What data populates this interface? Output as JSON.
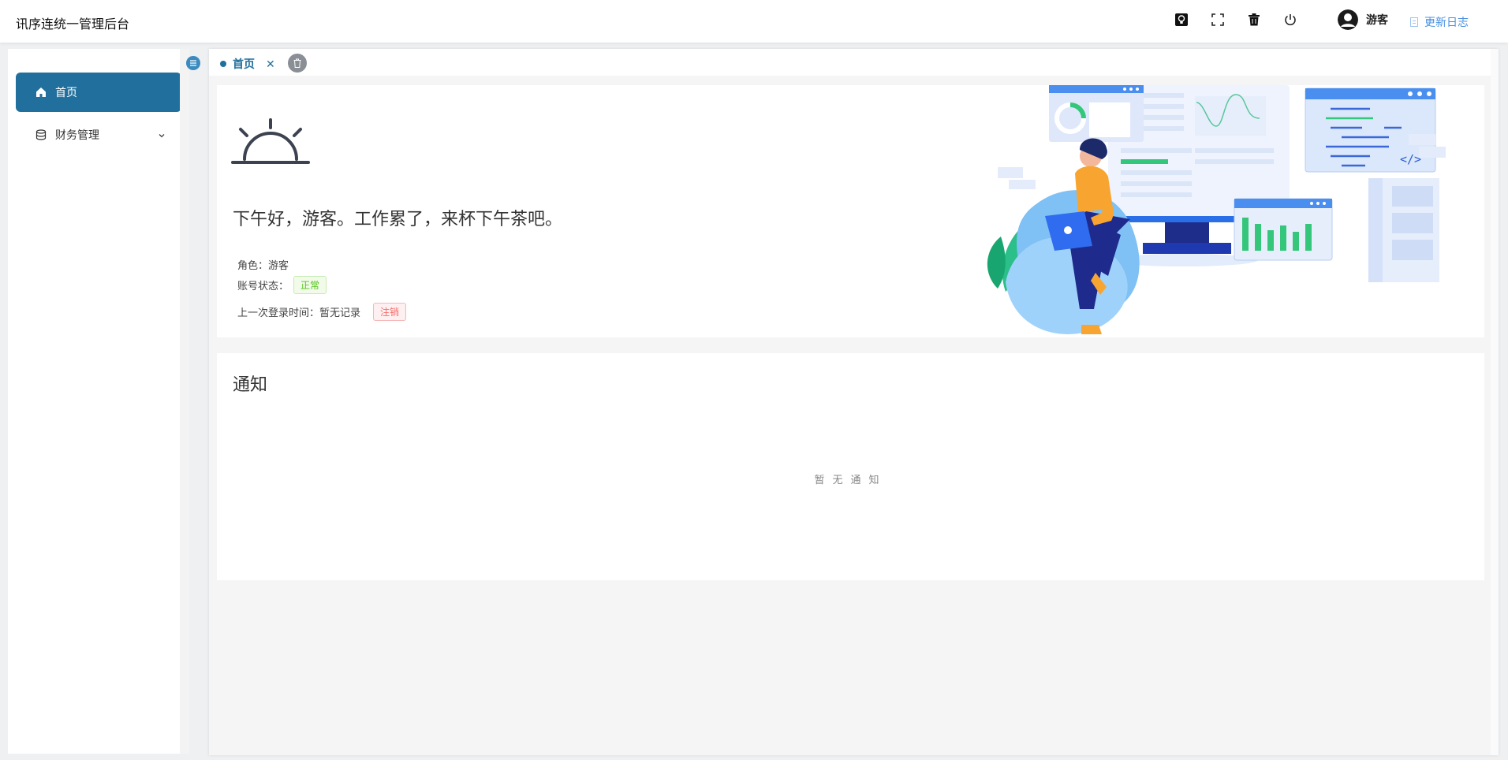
{
  "app": {
    "title": "讯序连统一管理后台"
  },
  "header": {
    "icons": [
      "lightbulb-icon",
      "fullscreen-icon",
      "trash-icon",
      "power-icon"
    ],
    "user_name": "游客",
    "changelog_label": "更新日志"
  },
  "sidebar": {
    "items": [
      {
        "label": "首页",
        "icon": "home-icon",
        "active": true
      },
      {
        "label": "财务管理",
        "icon": "database-icon",
        "active": false,
        "has_children": true
      }
    ]
  },
  "tabs": [
    {
      "label": "首页",
      "active": true
    }
  ],
  "welcome": {
    "greeting": "下午好，游客。工作累了，来杯下午茶吧。",
    "role_label": "角色：",
    "role_value": "游客",
    "status_label": "账号状态：",
    "status_value": "正常",
    "last_login_label": "上一次登录时间：",
    "last_login_value": "暂无记录",
    "logout_label": "注销"
  },
  "notice": {
    "title": "通知",
    "empty_text": "暂无通知"
  },
  "colors": {
    "accent": "#216f9c",
    "changelog": "#4a90e2",
    "success": "#52c41a",
    "danger": "#f56c6c"
  }
}
